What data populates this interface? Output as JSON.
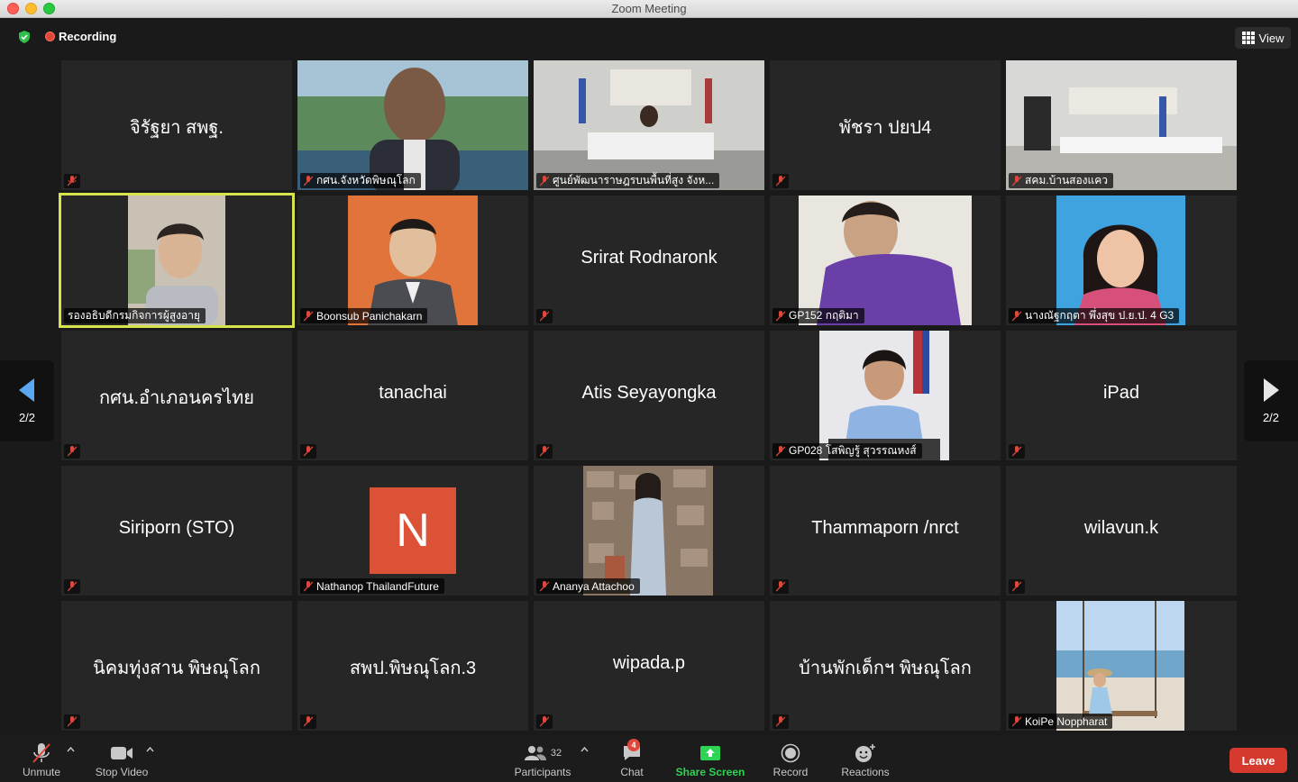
{
  "window": {
    "title": "Zoom Meeting"
  },
  "status": {
    "recording_label": "Recording",
    "view_label": "View"
  },
  "pager": {
    "left_label": "2/2",
    "right_label": "2/2"
  },
  "tiles": {
    "t1": "จิรัฐยา สพฐ.",
    "t2": "กศน.จังหวัดพิษณุโลก",
    "t3": "ศูนย์พัฒนาราษฎรบนพื้นที่สูง จังห...",
    "t4": "พัชรา ปยป4",
    "t5": "สคม.บ้านสองแคว",
    "t6": "รองอธิบดีกรมกิจการผู้สูงอายุ",
    "t7": "Boonsub Panichakarn",
    "t8": "Srirat Rodnaronk",
    "t9": "GP152 กฤติมา",
    "t10": "นางณัฐกฤตา พึ่งสุข ป.ย.ป. 4 G3",
    "t11": "กศน.อำเภอนครไทย",
    "t12": "tanachai",
    "t13": "Atis Seyayongka",
    "t14": "GP028 โสพิญรู้ สุวรรณหงส์",
    "t15": "iPad",
    "t16": "Siriporn (STO)",
    "t17": "Nathanop ThailandFuture",
    "t17_avatar_letter": "N",
    "t18": "Ananya Attachoo",
    "t19": "Thammaporn  /nrct",
    "t20": "wilavun.k",
    "t21": "นิคมทุ่งสาน พิษณุโลก",
    "t22": "สพป.พิษณุโลก.3",
    "t23": "wipada.p",
    "t24": "บ้านพักเด็กฯ พิษณุโลก",
    "t25": "KoiPe Noppharat"
  },
  "toolbar": {
    "unmute": "Unmute",
    "stop_video": "Stop Video",
    "participants": "Participants",
    "participants_count": "32",
    "chat": "Chat",
    "chat_badge": "4",
    "share_screen": "Share Screen",
    "record": "Record",
    "reactions": "Reactions",
    "leave": "Leave"
  },
  "colors": {
    "active_speaker": "#d7e34c",
    "leave": "#d63a2e",
    "share": "#2dd454",
    "muted": "#e0463a"
  }
}
